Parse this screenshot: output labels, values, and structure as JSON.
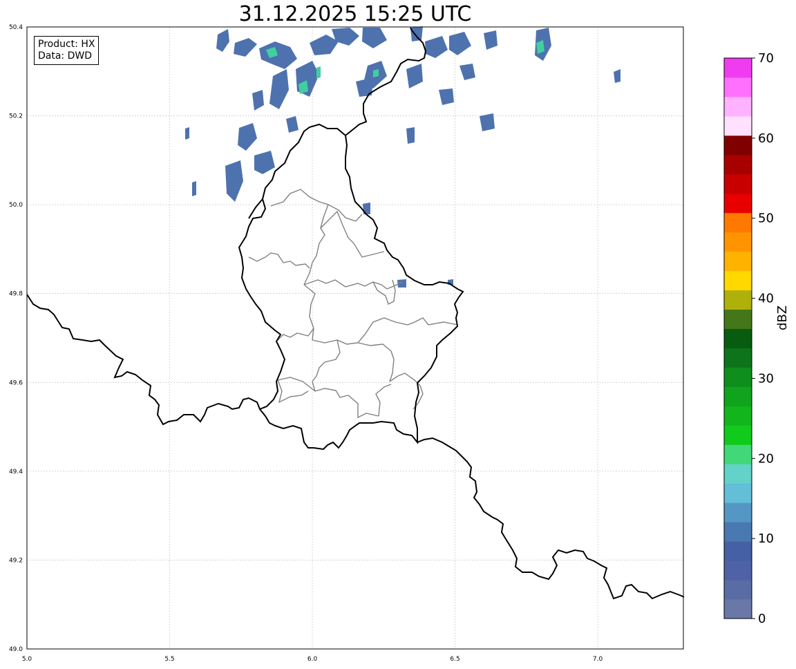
{
  "title": "31.12.2025 15:25 UTC",
  "info_box": {
    "line1": "Product: HX",
    "line2": "Data: DWD"
  },
  "map": {
    "lon_ticks": [
      "5.0",
      "5.5",
      "6.0",
      "6.5",
      "7.0"
    ],
    "lat_ticks": [
      "49.0",
      "49.2",
      "49.4",
      "49.6",
      "49.8",
      "50.0",
      "50.2",
      "50.4"
    ],
    "lon_range": [
      5.0,
      7.3
    ],
    "lat_range": [
      49.0,
      50.4
    ],
    "grid": true,
    "colors": {
      "border": "#000000",
      "canton": "#7f7f7f",
      "grid": "#bbbbbb"
    }
  },
  "colorbar": {
    "label": "dBZ",
    "ticks": [
      "0",
      "10",
      "20",
      "30",
      "40",
      "50",
      "60",
      "70"
    ],
    "range": [
      0,
      70
    ],
    "step": 2.5,
    "colors": [
      "#6a78a8",
      "#5a6ca4",
      "#5062a6",
      "#4560a4",
      "#4a78b0",
      "#5597c4",
      "#63bed8",
      "#63d2c8",
      "#42d878",
      "#10cb1c",
      "#12b51c",
      "#10a41c",
      "#0e8e1c",
      "#0e741c",
      "#075c10",
      "#44761a",
      "#afb00a",
      "#ffd800",
      "#ffb200",
      "#ff9400",
      "#ff7800",
      "#e80000",
      "#c80000",
      "#a80000",
      "#800000",
      "#ffe0ff",
      "#ffb2ff",
      "#ff70ff",
      "#f03cf0"
    ]
  }
}
